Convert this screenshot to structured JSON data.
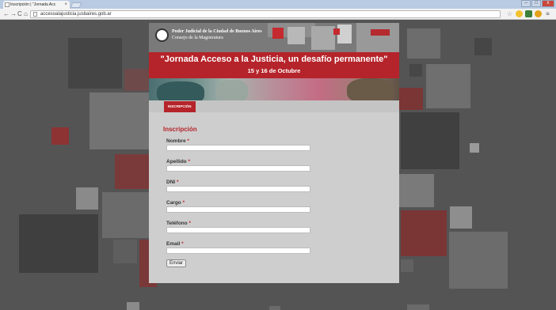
{
  "browser": {
    "tab_title": "Inscripción | \"Jornada Acc",
    "tab_close": "×",
    "url": "accesoalajusticia.jusbaires.gob.ar",
    "back": "←",
    "forward": "→",
    "reload": "C",
    "home": "⌂",
    "minimize": "–",
    "maximize": "□",
    "close": "x",
    "star": "☆",
    "menu": "≡"
  },
  "header": {
    "org_line1": "Poder Judicial de la Ciudad de Buenos Aires",
    "org_line2": "Consejo de la Magistratura"
  },
  "banner": {
    "title": "\"Jornada Acceso a la Justicia, un desafío permanente\"",
    "date": "15 y 16 de Octubre"
  },
  "nav": {
    "tab": "INSCRIPCIÓN"
  },
  "form": {
    "title": "Inscripción",
    "required_mark": "*",
    "fields": [
      {
        "label": "Nombre",
        "value": ""
      },
      {
        "label": "Apellido",
        "value": ""
      },
      {
        "label": "DNI",
        "value": ""
      },
      {
        "label": "Cargo",
        "value": ""
      },
      {
        "label": "Teléfono",
        "value": ""
      },
      {
        "label": "Email",
        "value": ""
      }
    ],
    "submit": "Enviar"
  },
  "colors": {
    "accent": "#b5242a",
    "background": "#545454",
    "form_bg": "#cecece"
  }
}
